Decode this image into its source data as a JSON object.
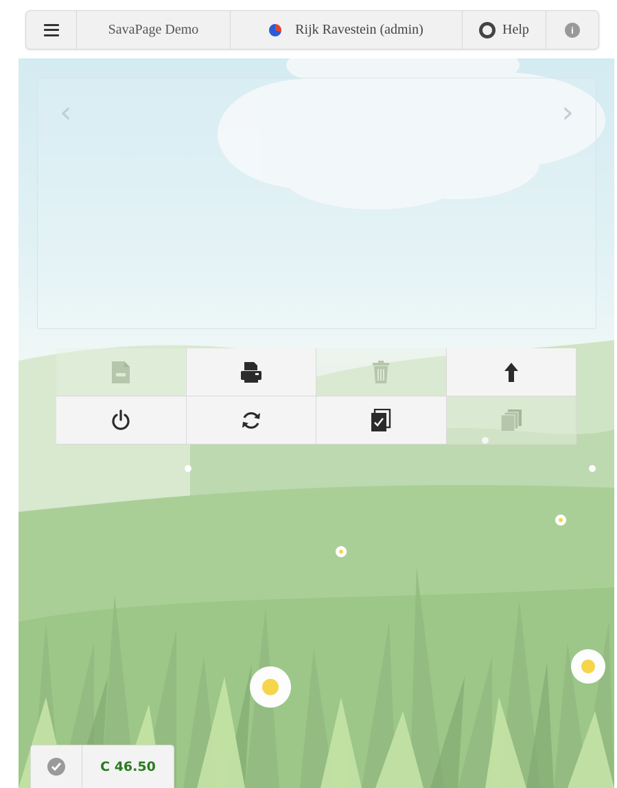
{
  "toolbar": {
    "menu_icon": "hamburger-menu-icon",
    "title": "SavaPage Demo",
    "user": "Rijk Ravestein (admin)",
    "user_icon": "user-status-dot-icon",
    "help": "Help",
    "help_icon": "lifebuoy-icon",
    "info": "i",
    "info_icon": "info-circle-icon"
  },
  "carousel": {
    "prev": "‹",
    "next": "›"
  },
  "actions": [
    {
      "icon": "pdf-file-icon",
      "enabled": false
    },
    {
      "icon": "printer-icon",
      "enabled": true
    },
    {
      "icon": "trash-icon",
      "enabled": false
    },
    {
      "icon": "upload-arrow-icon",
      "enabled": true
    },
    {
      "icon": "power-icon",
      "enabled": true
    },
    {
      "icon": "refresh-icon",
      "enabled": true
    },
    {
      "icon": "select-all-icon",
      "enabled": true
    },
    {
      "icon": "copy-pages-icon",
      "enabled": false
    }
  ],
  "balance": {
    "icon": "check-circle-icon",
    "amount": "C 46.50",
    "amount_color": "#2a7a1f"
  },
  "colors": {
    "sky": "#d3ebf1",
    "grass": "#a9cf96",
    "toolbar_bg": "#f1f1f1"
  }
}
